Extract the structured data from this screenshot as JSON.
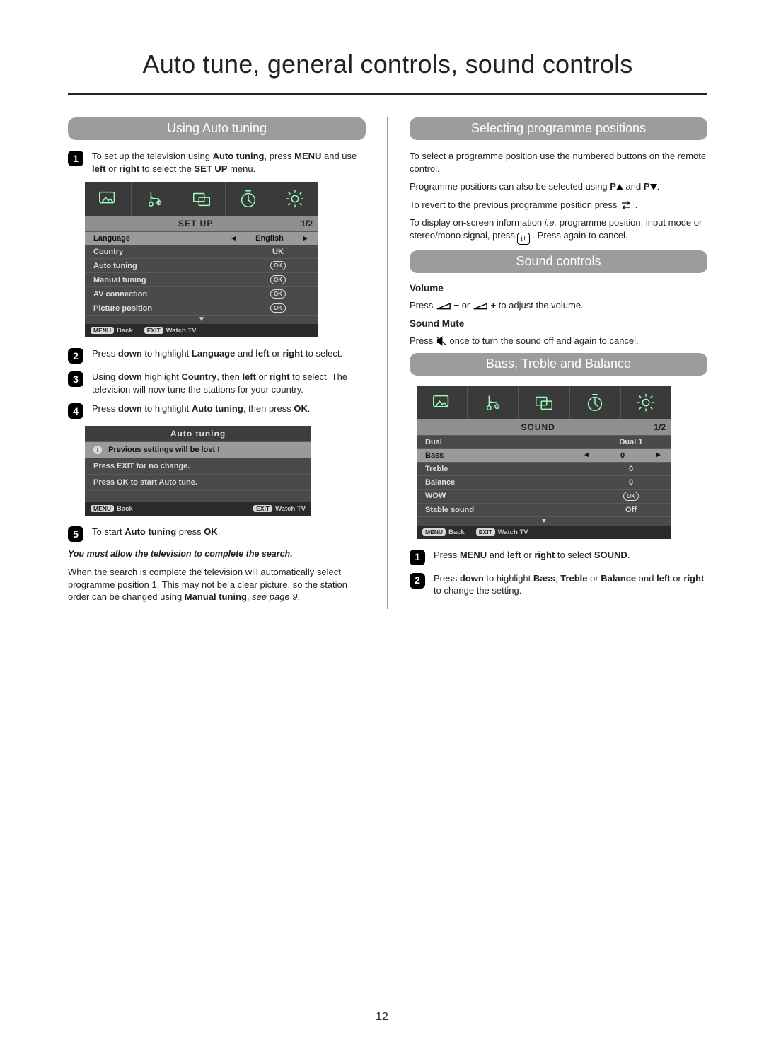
{
  "page_title": "Auto tune, general controls, sound controls",
  "page_number": "12",
  "left": {
    "pill_using_auto_tuning": "Using Auto tuning",
    "step1_html": "To set up the television using <b>Auto tuning</b>, press <b>MENU</b> and use <b>left</b> or <b>right</b> to select the <b>SET UP</b> menu.",
    "step2_html": "Press <b>down</b> to highlight <b>Language</b> and <b>left</b> or <b>right</b> to select.",
    "step3_html": "Using <b>down</b> highlight <b>Country</b>, then <b>left</b> or <b>right</b> to select. The television will now tune the stations for your country.",
    "step4_html": "Press <b>down</b> to highlight <b>Auto tuning</b>, then press <b>OK</b>.",
    "step5_html": "To start <b>Auto tuning</b> press <b>OK</b>.",
    "ital_note": "You must allow the television to complete the search.",
    "closing_html": "When the search is complete the television will automatically select programme position 1. This may not be a clear picture, so the station order can be changed using <b>Manual tuning</b>, <i>see page 9</i>."
  },
  "osd_setup": {
    "title": "SET UP",
    "page": "1/2",
    "rows": [
      {
        "label": "Language",
        "value": "English",
        "selected": true,
        "arrows": true
      },
      {
        "label": "Country",
        "value": "UK"
      },
      {
        "label": "Auto tuning",
        "value_ok": true
      },
      {
        "label": "Manual tuning",
        "value_ok": true
      },
      {
        "label": "AV connection",
        "value_ok": true
      },
      {
        "label": "Picture position",
        "value_ok": true
      }
    ],
    "footer_back": "Back",
    "footer_watch": "Watch TV",
    "footer_menu_tag": "MENU",
    "footer_exit_tag": "EXIT"
  },
  "osd_autotune": {
    "title": "Auto tuning",
    "line1": "Previous settings will be lost  !",
    "line2": "Press EXIT for no change.",
    "line3": "Press OK to start Auto tune.",
    "footer_back": "Back",
    "footer_watch": "Watch TV",
    "footer_menu_tag": "MENU",
    "footer_exit_tag": "EXIT"
  },
  "right": {
    "pill_selecting": "Selecting programme positions",
    "sel_p1": "To select a programme position use the numbered buttons on the remote control.",
    "sel_p2_pre": "Programme positions can also be selected using ",
    "sel_p2_pup": "P",
    "sel_p2_mid": " and ",
    "sel_p2_pdn": "P",
    "sel_p2_post": ".",
    "sel_p3_pre": "To revert to the previous programme position press ",
    "sel_p3_post": ".",
    "sel_p4_pre": "To display on-screen information ",
    "sel_p4_ie": "i.e.",
    "sel_p4_mid": " programme position, input mode or stereo/mono signal, press ",
    "sel_p4_post": ". Press again to cancel.",
    "pill_sound": "Sound controls",
    "volume_head": "Volume",
    "volume_pre": "Press ",
    "volume_minus": "−",
    "volume_or": " or ",
    "volume_plus": "+",
    "volume_post": " to adjust the volume.",
    "mute_head": "Sound Mute",
    "mute_pre": "Press ",
    "mute_post": " once to turn the sound off and again to cancel.",
    "pill_bass": "Bass, Treble and Balance",
    "bass_step1_html": "Press <b>MENU</b> and <b>left</b> or <b>right</b> to select <b>SOUND</b>.",
    "bass_step2_html": "Press <b>down</b> to highlight <b>Bass</b>, <b>Treble</b> or <b>Balance</b> and <b>left</b> or <b>right</b> to change the setting."
  },
  "osd_sound": {
    "title": "SOUND",
    "page": "1/2",
    "rows": [
      {
        "label": "Dual",
        "value": "Dual 1"
      },
      {
        "label": "Bass",
        "value": "0",
        "selected": true,
        "arrows": true
      },
      {
        "label": "Treble",
        "value": "0"
      },
      {
        "label": "Balance",
        "value": "0"
      },
      {
        "label": "WOW",
        "value_ok": true
      },
      {
        "label": "Stable sound",
        "value": "Off"
      }
    ],
    "footer_back": "Back",
    "footer_watch": "Watch TV",
    "footer_menu_tag": "MENU",
    "footer_exit_tag": "EXIT"
  },
  "icons": {
    "swap": "swap-icon",
    "info": "info-plus-icon",
    "vol": "volume-wedge-icon",
    "mute": "mute-icon"
  }
}
